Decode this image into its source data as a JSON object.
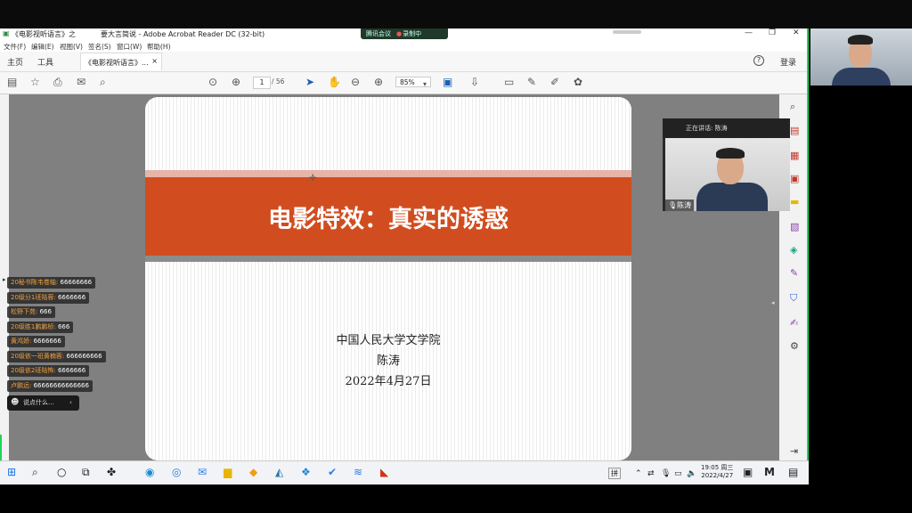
{
  "window": {
    "title_left": "《电影视听语言》之",
    "title_right": "要大言简说 - Adobe Acrobat Reader DC (32-bit)",
    "meeting_label": "腾讯会议",
    "recording_label": "录制中"
  },
  "menu": [
    "文件(F)",
    "编辑(E)",
    "视图(V)",
    "签名(S)",
    "窗口(W)",
    "帮助(H)"
  ],
  "tabs": {
    "home": "主页",
    "tools": "工具",
    "doc": "《电影视听语言》...",
    "close": "×",
    "help": "?",
    "login": "登录"
  },
  "toolbar": {
    "page_current": "1",
    "page_total": "/ 56",
    "zoom": "85%"
  },
  "slide": {
    "title": "电影特效：真实的诱惑",
    "institution": "中国人民大学文学院",
    "author": "陈涛",
    "date": "2022年4月27日"
  },
  "video": {
    "speaking": "正在讲话: 陈涛",
    "name": "陈涛"
  },
  "danmaku": [
    {
      "user": "20秘书陈韦卷轴:",
      "msg": "66666666"
    },
    {
      "user": "20级分1班陆蓉:",
      "msg": "6666666"
    },
    {
      "user": "松野下苑:",
      "msg": "666"
    },
    {
      "user": "20级胜1鹏鹏桢:",
      "msg": "666"
    },
    {
      "user": "黄鸿娇:",
      "msg": "6666666"
    },
    {
      "user": "20级依一班黄楠蓉:",
      "msg": "666666666"
    },
    {
      "user": "20级依2班陆怖:",
      "msg": "6666666"
    },
    {
      "user": "卢鹏远:",
      "msg": "66666666666666"
    }
  ],
  "chat_placeholder": "说点什么...",
  "taskbar": {
    "time": "19:05 周三",
    "date": "2022/4/27",
    "ime": "拼"
  }
}
